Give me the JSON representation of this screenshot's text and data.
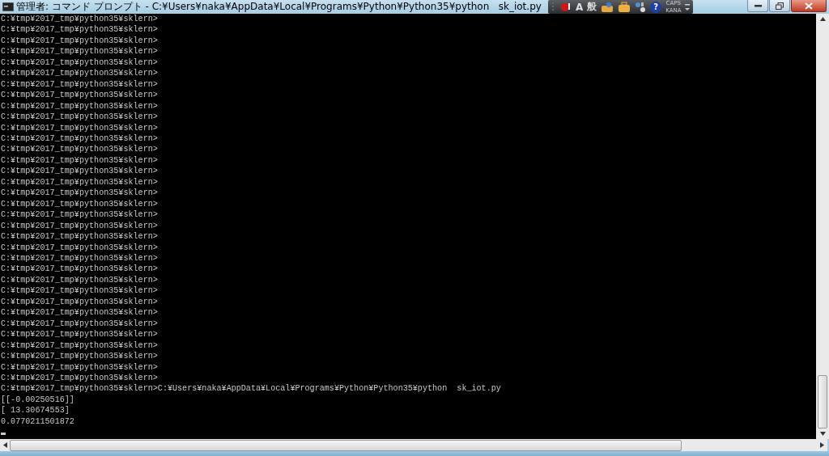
{
  "window": {
    "title": "管理者: コマンド プロンプト - C:¥Users¥naka¥AppData¥Local¥Programs¥Python¥Python35¥python   sk_iot.py"
  },
  "ime_bar": {
    "mode_latin": "A",
    "mode_kanji": "般",
    "help": "?",
    "caps": "CAPS",
    "kana": "KANA"
  },
  "console": {
    "lines": [
      "C:¥tmp¥2017_tmp¥python35¥sklern>",
      "C:¥tmp¥2017_tmp¥python35¥sklern>",
      "C:¥tmp¥2017_tmp¥python35¥sklern>",
      "C:¥tmp¥2017_tmp¥python35¥sklern>",
      "C:¥tmp¥2017_tmp¥python35¥sklern>",
      "C:¥tmp¥2017_tmp¥python35¥sklern>",
      "C:¥tmp¥2017_tmp¥python35¥sklern>",
      "C:¥tmp¥2017_tmp¥python35¥sklern>",
      "C:¥tmp¥2017_tmp¥python35¥sklern>",
      "C:¥tmp¥2017_tmp¥python35¥sklern>",
      "C:¥tmp¥2017_tmp¥python35¥sklern>",
      "C:¥tmp¥2017_tmp¥python35¥sklern>",
      "C:¥tmp¥2017_tmp¥python35¥sklern>",
      "C:¥tmp¥2017_tmp¥python35¥sklern>",
      "C:¥tmp¥2017_tmp¥python35¥sklern>",
      "C:¥tmp¥2017_tmp¥python35¥sklern>",
      "C:¥tmp¥2017_tmp¥python35¥sklern>",
      "C:¥tmp¥2017_tmp¥python35¥sklern>",
      "C:¥tmp¥2017_tmp¥python35¥sklern>",
      "C:¥tmp¥2017_tmp¥python35¥sklern>",
      "C:¥tmp¥2017_tmp¥python35¥sklern>",
      "C:¥tmp¥2017_tmp¥python35¥sklern>",
      "C:¥tmp¥2017_tmp¥python35¥sklern>",
      "C:¥tmp¥2017_tmp¥python35¥sklern>",
      "C:¥tmp¥2017_tmp¥python35¥sklern>",
      "C:¥tmp¥2017_tmp¥python35¥sklern>",
      "C:¥tmp¥2017_tmp¥python35¥sklern>",
      "C:¥tmp¥2017_tmp¥python35¥sklern>",
      "C:¥tmp¥2017_tmp¥python35¥sklern>",
      "C:¥tmp¥2017_tmp¥python35¥sklern>",
      "C:¥tmp¥2017_tmp¥python35¥sklern>",
      "C:¥tmp¥2017_tmp¥python35¥sklern>",
      "C:¥tmp¥2017_tmp¥python35¥sklern>",
      "C:¥tmp¥2017_tmp¥python35¥sklern>",
      "C:¥tmp¥2017_tmp¥python35¥sklern>C:¥Users¥naka¥AppData¥Local¥Programs¥Python¥Python35¥python  sk_iot.py",
      "[[-0.00250516]]",
      "[ 13.30674553]",
      "0.0770211501872"
    ]
  }
}
